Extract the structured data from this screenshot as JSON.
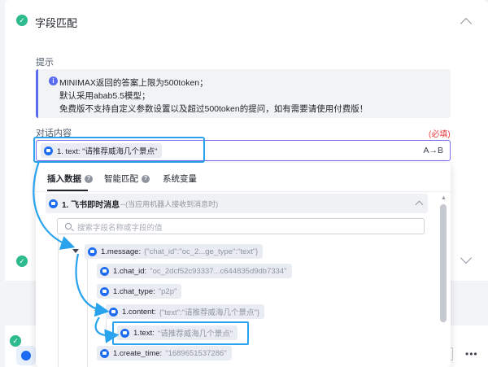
{
  "header": {
    "title": "字段匹配"
  },
  "hint": {
    "label": "提示",
    "lines": [
      "MINIMAX返回的答案上限为500token；",
      "默认采用abab5.5模型；",
      "免费版不支持自定义参数设置以及超过500token的提问，如有需要请使用付费版！"
    ]
  },
  "conversation": {
    "label": "对话内容",
    "required": "(必填)",
    "chip_text": "1. text: \"请推荐威海几个景点\"",
    "ab_label": "A→B"
  },
  "dropdown": {
    "tabs": [
      "插入数据",
      "智能匹配",
      "系统变量"
    ],
    "section_title": "1. 飞书即时消息",
    "section_sub": "--(当应用机器人接收到消息时)",
    "search_placeholder": "搜索字段名称或字段的值",
    "items": [
      {
        "key": "1.message:",
        "value": "{\"chat_id\":\"oc_2...ge_type\":\"text\"}"
      },
      {
        "key": "1.chat_id:",
        "value": "\"oc_2dcf52c93337...c644835d9db7334\""
      },
      {
        "key": "1.chat_type:",
        "value": "\"p2p\""
      },
      {
        "key": "1.content:",
        "value": "{\"text\":\"请推荐威海几个景点\"}"
      },
      {
        "key": "1.text:",
        "value": "\"请推荐威海几个景点\""
      },
      {
        "key": "1.create_time:",
        "value": "\"1689651537286\""
      }
    ]
  },
  "colors": {
    "accent": "#29a3ee",
    "success": "#2dbb8e",
    "brand": "#1d6cf2",
    "required": "#e83d3d"
  }
}
